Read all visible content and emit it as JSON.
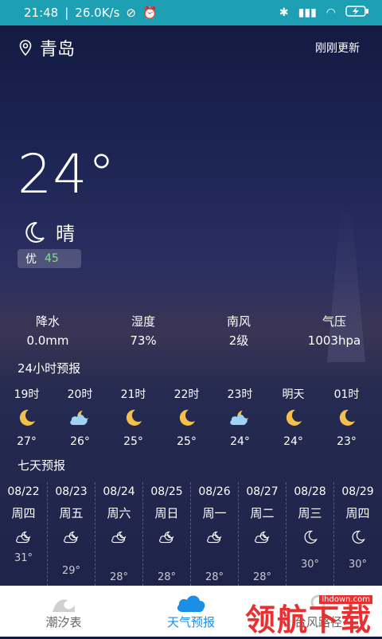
{
  "status_bar": {
    "time": "21:48",
    "speed": "26.0K/s",
    "battery_icon": "battery-charging-icon"
  },
  "header": {
    "city": "青岛",
    "update": "刚刚更新"
  },
  "current": {
    "temp": "24°",
    "condition": "晴",
    "aqi_label": "优",
    "aqi_value": "45"
  },
  "stats": [
    {
      "label": "降水",
      "value": "0.0mm"
    },
    {
      "label": "湿度",
      "value": "73%"
    },
    {
      "label": "南风",
      "value": "2级"
    },
    {
      "label": "气压",
      "value": "1003hpa"
    }
  ],
  "hourly_title": "24小时预报",
  "hourly": [
    {
      "time": "19时",
      "icon": "moon-icon",
      "temp": "27°"
    },
    {
      "time": "20时",
      "icon": "cloud-moon-icon",
      "temp": "26°"
    },
    {
      "time": "21时",
      "icon": "moon-icon",
      "temp": "25°"
    },
    {
      "time": "22时",
      "icon": "moon-icon",
      "temp": "25°"
    },
    {
      "time": "23时",
      "icon": "cloud-moon-icon",
      "temp": "24°"
    },
    {
      "time": "明天",
      "icon": "moon-icon",
      "temp": "24°"
    },
    {
      "time": "01时",
      "icon": "moon-icon",
      "temp": "23°"
    }
  ],
  "daily_title": "七天预报",
  "daily": [
    {
      "date": "08/22",
      "weekday": "周四",
      "icon": "cloud-moon-icon",
      "hi": "31°"
    },
    {
      "date": "08/23",
      "weekday": "周五",
      "icon": "cloud-moon-icon",
      "hi": "29°"
    },
    {
      "date": "08/24",
      "weekday": "周六",
      "icon": "cloud-moon-icon",
      "hi": "28°"
    },
    {
      "date": "08/25",
      "weekday": "周日",
      "icon": "cloud-moon-icon",
      "hi": "28°"
    },
    {
      "date": "08/26",
      "weekday": "周一",
      "icon": "cloud-moon-icon",
      "hi": "28°"
    },
    {
      "date": "08/27",
      "weekday": "周二",
      "icon": "cloud-moon-icon",
      "hi": "28°"
    },
    {
      "date": "08/28",
      "weekday": "周三",
      "icon": "moon-icon",
      "hi": "30°"
    },
    {
      "date": "08/29",
      "weekday": "周四",
      "icon": "moon-icon",
      "hi": "30°"
    }
  ],
  "tabs": [
    {
      "label": "潮汐表",
      "icon": "wave-icon",
      "active": false
    },
    {
      "label": "天气预报",
      "icon": "cloud-icon",
      "active": true
    },
    {
      "label": "台风路径",
      "icon": "typhoon-icon",
      "active": false
    }
  ],
  "watermark": {
    "text": "领航下载",
    "url": "lhdown.com"
  },
  "colors": {
    "status_bar": "#1ea0b4",
    "active_tab": "#1b8fe6",
    "aqi_value": "#7fe08a",
    "watermark": "#e83030"
  }
}
